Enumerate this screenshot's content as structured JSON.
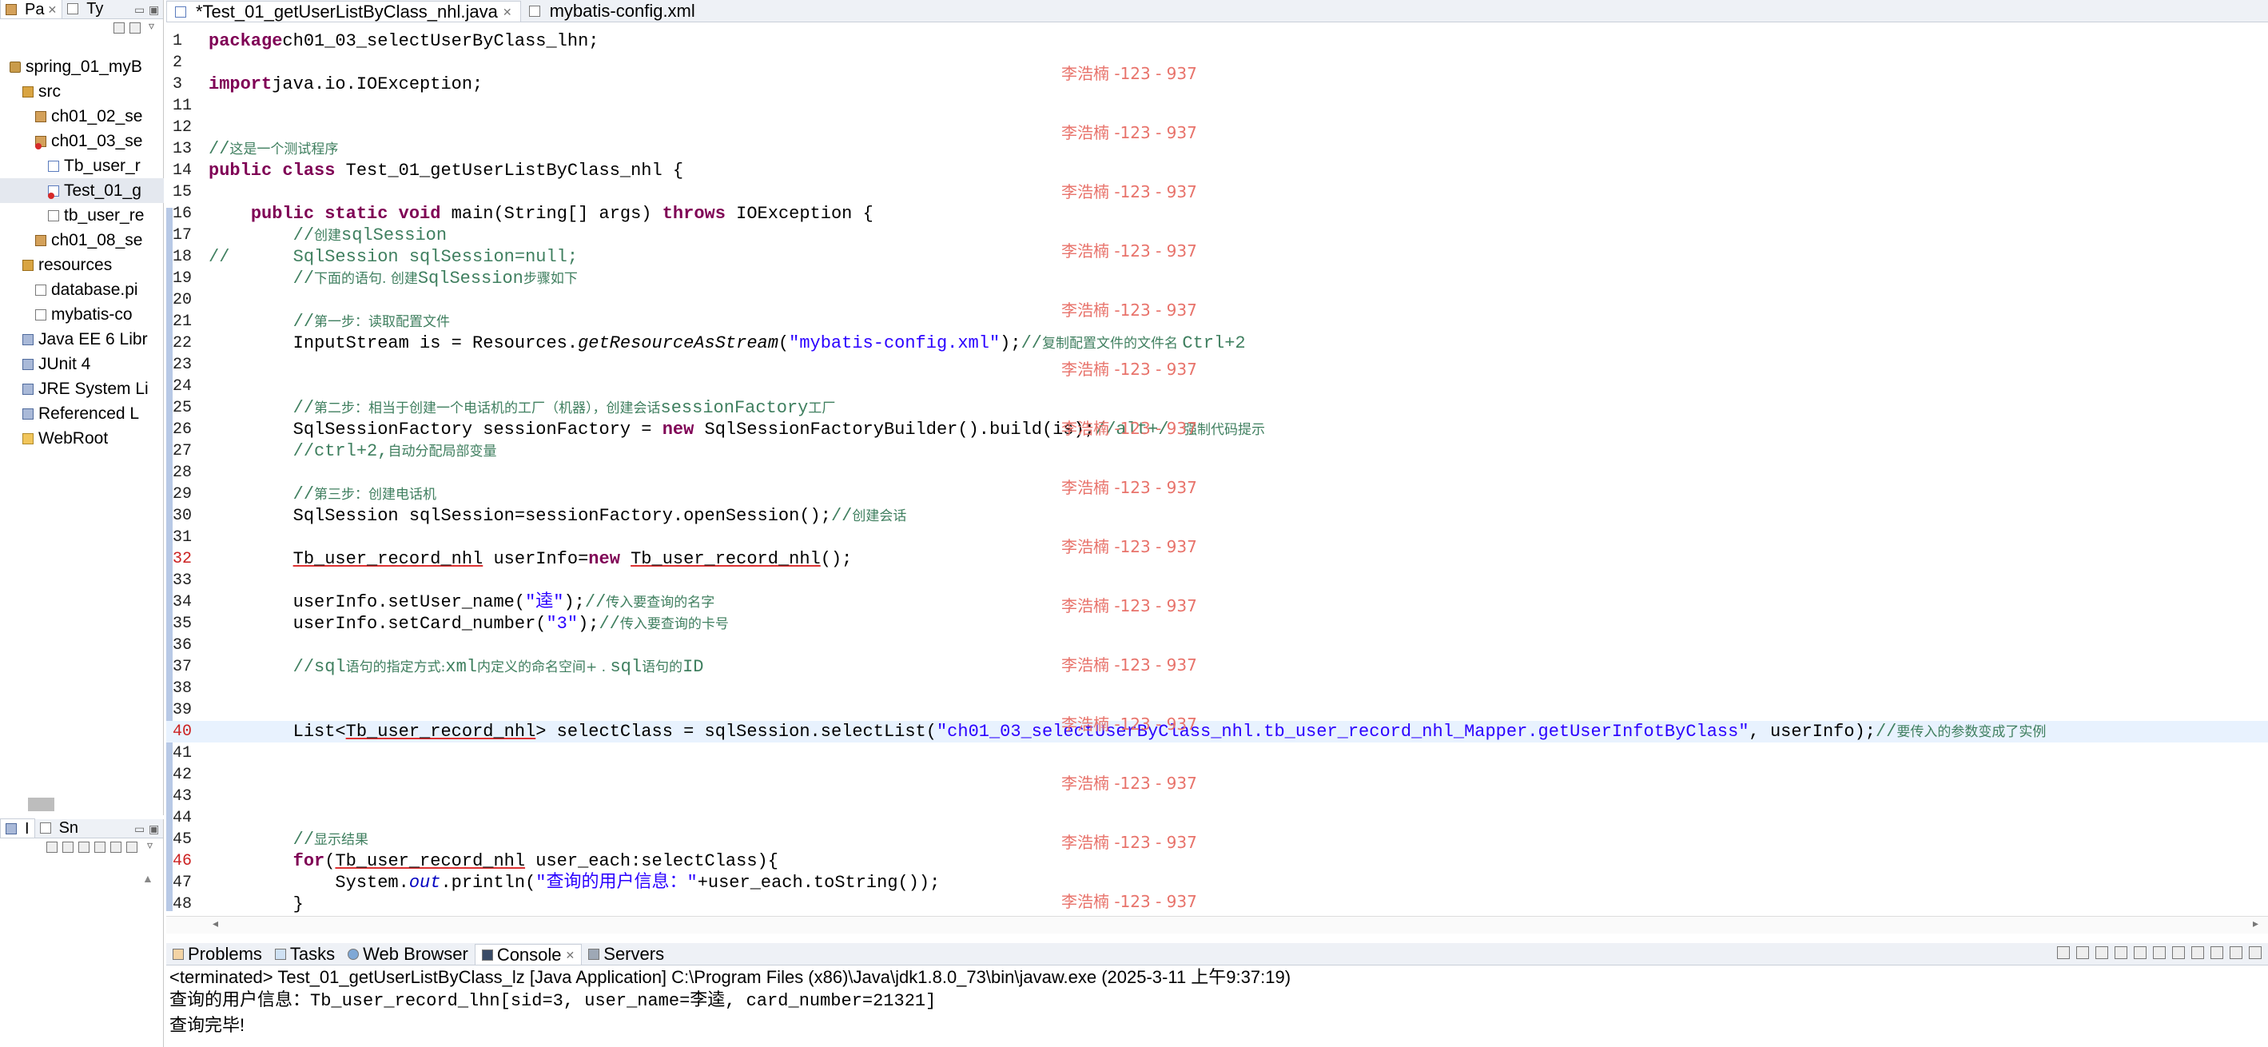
{
  "left_pane": {
    "tabs": [
      {
        "label": "Pa",
        "close": "✕"
      },
      {
        "label": "Ty",
        "close": ""
      }
    ],
    "tree": [
      {
        "label": "spring_01_myB",
        "indent": 1,
        "icon": "project-icon"
      },
      {
        "label": "src",
        "indent": 2,
        "icon": "source-folder-icon"
      },
      {
        "label": "ch01_02_se",
        "indent": 3,
        "icon": "package-icon"
      },
      {
        "label": "ch01_03_se",
        "indent": 3,
        "icon": "package-icon"
      },
      {
        "label": "Tb_user_r",
        "indent": 4,
        "icon": "java-file-icon"
      },
      {
        "label": "Test_01_g",
        "indent": 4,
        "icon": "java-file-icon"
      },
      {
        "label": "tb_user_re",
        "indent": 4,
        "icon": "xml-file-icon"
      },
      {
        "label": "ch01_08_se",
        "indent": 3,
        "icon": "package-icon"
      },
      {
        "label": "resources",
        "indent": 2,
        "icon": "source-folder-icon"
      },
      {
        "label": "database.pi",
        "indent": 3,
        "icon": "file-icon"
      },
      {
        "label": "mybatis-co",
        "indent": 3,
        "icon": "xml-file-icon"
      },
      {
        "label": "Java EE 6 Libr",
        "indent": 2,
        "icon": "library-icon"
      },
      {
        "label": "JUnit 4",
        "indent": 2,
        "icon": "library-icon"
      },
      {
        "label": "JRE System Li",
        "indent": 2,
        "icon": "library-icon"
      },
      {
        "label": "Referenced L",
        "indent": 2,
        "icon": "library-icon"
      },
      {
        "label": "WebRoot",
        "indent": 2,
        "icon": "folder-icon"
      }
    ],
    "bottom_tabs": [
      {
        "label": "I"
      },
      {
        "label": "Sn"
      }
    ]
  },
  "editor": {
    "tabs": [
      {
        "label": "*Test_01_getUserListByClass_nhl.java",
        "close": "✕"
      },
      {
        "label": "mybatis-config.xml",
        "close": ""
      }
    ]
  },
  "watermark": "李浩楠 -123 - 937",
  "console": {
    "tabs": [
      "Problems",
      "Tasks",
      "Web Browser",
      "Console",
      "Servers"
    ],
    "status": "<terminated> Test_01_getUserListByClass_lz [Java Application] C:\\Program Files (x86)\\Java\\jdk1.8.0_73\\bin\\javaw.exe (2025-3-11 上午9:37:19)",
    "output": [
      "查询的用户信息：Tb_user_record_lhn[sid=3, user_name=李逵, card_number=21321]",
      "查询完毕!"
    ]
  },
  "code_lines": [
    {
      "n": "1",
      "segs": [
        [
          "kw",
          "package"
        ],
        [
          "",
          "ch01_03_selectUserByClass_lhn;"
        ]
      ]
    },
    {
      "n": "2",
      "segs": []
    },
    {
      "n": "3",
      "segs": [
        [
          "kw",
          "import"
        ],
        [
          "",
          "java.io.IOException;"
        ]
      ]
    },
    {
      "n": "11",
      "segs": []
    },
    {
      "n": "12",
      "segs": []
    },
    {
      "n": "13",
      "segs": [
        [
          "cmt",
          "//"
        ],
        [
          "cmt-cn",
          "这是一个测试程序"
        ]
      ]
    },
    {
      "n": "14",
      "segs": [
        [
          "kw",
          "public"
        ],
        [
          "",
          " "
        ],
        [
          "kw",
          "class"
        ],
        [
          "",
          " Test_01_getUserListByClass_nhl {"
        ]
      ]
    },
    {
      "n": "15",
      "segs": []
    },
    {
      "n": "16",
      "segs": [
        [
          "",
          "    "
        ],
        [
          "kw",
          "public"
        ],
        [
          "",
          " "
        ],
        [
          "kw",
          "static"
        ],
        [
          "",
          " "
        ],
        [
          "kw",
          "void"
        ],
        [
          "",
          " main(String[] args) "
        ],
        [
          "kw",
          "throws"
        ],
        [
          "",
          " IOException {"
        ]
      ]
    },
    {
      "n": "17",
      "segs": [
        [
          "",
          "        "
        ],
        [
          "cmt",
          "//"
        ],
        [
          "cmt-cn",
          "创建"
        ],
        [
          "cmt",
          "sqlSession"
        ]
      ]
    },
    {
      "n": "18",
      "segs": [
        [
          "cmt",
          "//      SqlSession sqlSession=null;"
        ]
      ]
    },
    {
      "n": "19",
      "segs": [
        [
          "",
          "        "
        ],
        [
          "cmt",
          "//"
        ],
        [
          "cmt-cn",
          "下面的语句. 创建"
        ],
        [
          "cmt",
          "SqlSession"
        ],
        [
          "cmt-cn",
          "步骤如下"
        ]
      ]
    },
    {
      "n": "20",
      "segs": []
    },
    {
      "n": "21",
      "segs": [
        [
          "",
          "        "
        ],
        [
          "cmt",
          "//"
        ],
        [
          "cmt-cn",
          "第一步：读取配置文件"
        ]
      ]
    },
    {
      "n": "22",
      "segs": [
        [
          "",
          "        InputStream is = Resources."
        ],
        [
          "ital",
          "getResourceAsStream"
        ],
        [
          "",
          "("
        ],
        [
          "str",
          "\"mybatis-config.xml\""
        ],
        [
          "",
          ");"
        ],
        [
          "cmt",
          "//"
        ],
        [
          "cmt-cn",
          "复制配置文件的文件名 "
        ],
        [
          "cmt",
          "Ctrl+2"
        ]
      ]
    },
    {
      "n": "23",
      "segs": []
    },
    {
      "n": "24",
      "segs": []
    },
    {
      "n": "25",
      "segs": [
        [
          "",
          "        "
        ],
        [
          "cmt",
          "//"
        ],
        [
          "cmt-cn",
          "第二步：相当于创建一个电话机的工厂（机器），创建会话"
        ],
        [
          "cmt",
          "sessionFactory"
        ],
        [
          "cmt-cn",
          "工厂"
        ]
      ]
    },
    {
      "n": "26",
      "segs": [
        [
          "",
          "        SqlSessionFactory sessionFactory = "
        ],
        [
          "kw",
          "new"
        ],
        [
          "",
          " SqlSessionFactoryBuilder().build(is);"
        ],
        [
          "cmt",
          "//alt+/ "
        ],
        [
          "cmt-cn",
          " 强制代码提示"
        ]
      ]
    },
    {
      "n": "27",
      "segs": [
        [
          "",
          "        "
        ],
        [
          "cmt",
          "//ctrl+2,"
        ],
        [
          "cmt-cn",
          "自动分配局部变量"
        ]
      ]
    },
    {
      "n": "28",
      "segs": []
    },
    {
      "n": "29",
      "segs": [
        [
          "",
          "        "
        ],
        [
          "cmt",
          "//"
        ],
        [
          "cmt-cn",
          "第三步：创建电话机"
        ]
      ]
    },
    {
      "n": "30",
      "segs": [
        [
          "",
          "        SqlSession sqlSession=sessionFactory.openSession();"
        ],
        [
          "cmt",
          "//"
        ],
        [
          "cmt-cn",
          "创建会话"
        ]
      ]
    },
    {
      "n": "31",
      "segs": []
    },
    {
      "n": "32",
      "segs": [
        [
          "",
          "        "
        ],
        [
          "u",
          "Tb_user_record_nhl"
        ],
        [
          "",
          " userInfo="
        ],
        [
          "kw",
          "new"
        ],
        [
          "",
          " "
        ],
        [
          "u",
          "Tb_user_record_nhl"
        ],
        [
          "",
          "();"
        ]
      ]
    },
    {
      "n": "33",
      "segs": []
    },
    {
      "n": "34",
      "segs": [
        [
          "",
          "        userInfo.setUser_name("
        ],
        [
          "str",
          "\"逵\""
        ],
        [
          "",
          ");"
        ],
        [
          "cmt",
          "//"
        ],
        [
          "cmt-cn",
          "传入要查询的名字"
        ]
      ]
    },
    {
      "n": "35",
      "segs": [
        [
          "",
          "        userInfo.setCard_number("
        ],
        [
          "str",
          "\"3\""
        ],
        [
          "",
          ");"
        ],
        [
          "cmt",
          "//"
        ],
        [
          "cmt-cn",
          "传入要查询的卡号"
        ]
      ]
    },
    {
      "n": "36",
      "segs": []
    },
    {
      "n": "37",
      "segs": [
        [
          "",
          "        "
        ],
        [
          "cmt",
          "//sql"
        ],
        [
          "cmt-cn",
          "语句的指定方式:"
        ],
        [
          "cmt",
          "xml"
        ],
        [
          "cmt-cn",
          "内定义的命名空间+ . "
        ],
        [
          "cmt",
          "sql"
        ],
        [
          "cmt-cn",
          "语句的"
        ],
        [
          "cmt",
          "ID"
        ]
      ]
    },
    {
      "n": "38",
      "segs": []
    },
    {
      "n": "39",
      "segs": []
    },
    {
      "n": "40",
      "segs": [
        [
          "",
          "        List<"
        ],
        [
          "u",
          "Tb_user_record_nhl"
        ],
        [
          "",
          "> selectClass = sqlSession.selectList("
        ],
        [
          "str",
          "\"ch01_03_selectUserByClass_nhl.tb_user_record_nhl_Mapper.getUserInfotByClass\""
        ],
        [
          "",
          ", userInfo);"
        ],
        [
          "cmt",
          "//"
        ],
        [
          "cmt-cn",
          "要传入的参数变成了实例"
        ]
      ]
    },
    {
      "n": "41",
      "segs": []
    },
    {
      "n": "42",
      "segs": []
    },
    {
      "n": "43",
      "segs": []
    },
    {
      "n": "44",
      "segs": []
    },
    {
      "n": "45",
      "segs": [
        [
          "",
          "        "
        ],
        [
          "cmt",
          "//"
        ],
        [
          "cmt-cn",
          "显示结果"
        ]
      ]
    },
    {
      "n": "46",
      "segs": [
        [
          "",
          "        "
        ],
        [
          "kw",
          "for"
        ],
        [
          "",
          "("
        ],
        [
          "u",
          "Tb_user_record_nhl"
        ],
        [
          "",
          " user_each:selectClass){"
        ]
      ]
    },
    {
      "n": "47",
      "segs": [
        [
          "",
          "            System."
        ],
        [
          "italblue",
          "out"
        ],
        [
          "",
          ".println("
        ],
        [
          "str",
          "\"查询的用户信息：\""
        ],
        [
          "",
          "+user_each.toString());"
        ]
      ]
    },
    {
      "n": "48",
      "segs": [
        [
          "",
          "        }"
        ]
      ]
    }
  ]
}
